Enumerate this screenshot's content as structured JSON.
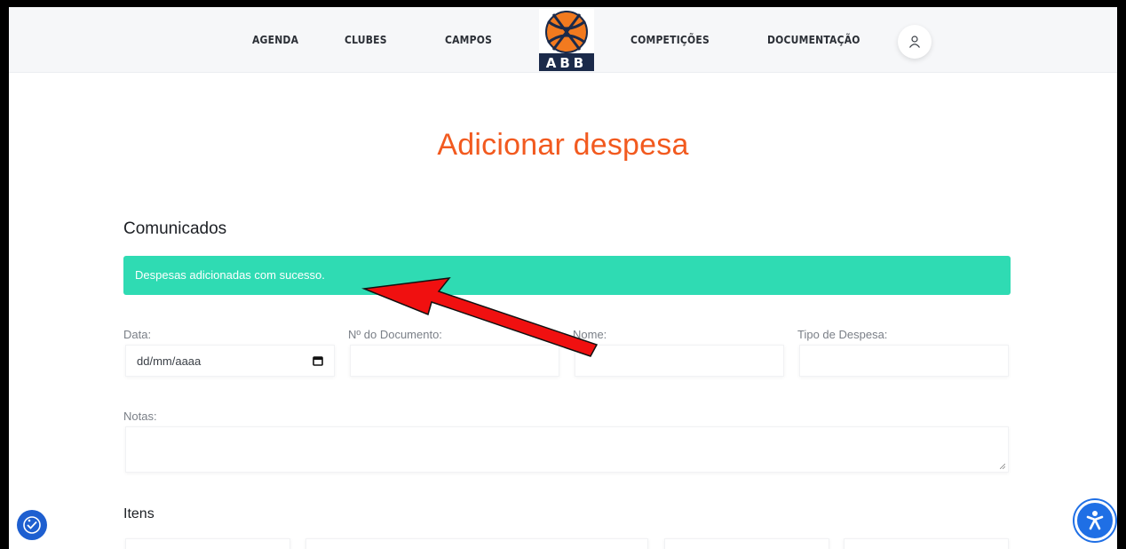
{
  "nav": {
    "agenda": "AGENDA",
    "clubes": "CLUBES",
    "campos": "CAMPOS",
    "competicoes": "COMPETIÇÕES",
    "documentacao": "DOCUMENTAÇÃO",
    "logo_text": "ABB"
  },
  "page": {
    "title": "Adicionar despesa"
  },
  "comunicados": {
    "heading": "Comunicados",
    "alert": "Despesas adicionadas com sucesso."
  },
  "form": {
    "data_label": "Data:",
    "data_placeholder": "dd/mm/aaaa",
    "documento_label": "Nº do Documento:",
    "nome_label": "Nome:",
    "tipo_label": "Tipo de Despesa:",
    "notas_label": "Notas:"
  },
  "itens": {
    "heading": "Itens"
  },
  "colors": {
    "accent": "#f25a1f",
    "success": "#2fdbb3",
    "annotation_arrow": "#f01010",
    "a11y_blue": "#1f6fe5"
  },
  "icons": [
    "user-icon",
    "calendar-icon",
    "accessibility-icon",
    "a11y-settings-icon",
    "basketball-logo"
  ]
}
